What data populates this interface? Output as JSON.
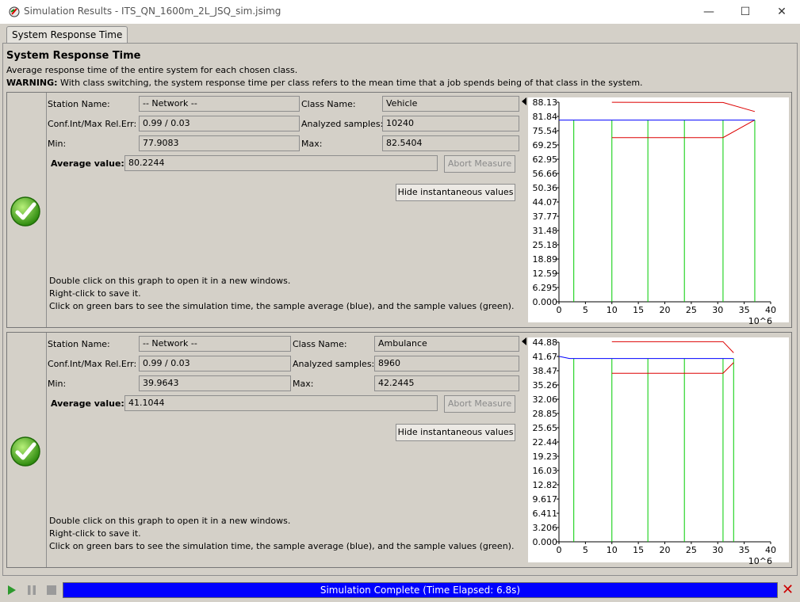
{
  "window": {
    "title": "Simulation Results - ITS_QN_1600m_2L_JSQ_sim.jsimg",
    "minimize": "—",
    "maximize": "☐",
    "close": "✕"
  },
  "tab": {
    "label": "System Response Time"
  },
  "page": {
    "heading": "System Response Time",
    "description": "Average response time of the entire system for each chosen class.",
    "warning_label": "WARNING:",
    "warning_text": " With class switching, the system response time per class refers to the mean time that a job spends being of that class in the system."
  },
  "labels": {
    "station_name": "Station Name:",
    "class_name": "Class Name:",
    "conf_int": "Conf.Int/Max Rel.Err:",
    "analyzed_samples": "Analyzed samples:",
    "min": "Min:",
    "max": "Max:",
    "average_value": "Average value:",
    "abort_measure": "Abort Measure",
    "hide_instantaneous": "Hide instantaneous values",
    "hint_line1": "Double click on this graph to open it in a new windows.",
    "hint_line2": "Right-click to save it.",
    "hint_line3": "Click on green bars to see the simulation time, the sample average (blue), and the sample values (green)."
  },
  "measures": [
    {
      "station_name": "-- Network --",
      "class_name": "Vehicle",
      "conf_int": "0.99 / 0.03",
      "analyzed_samples": "10240",
      "min": "77.9083",
      "max": "82.5404",
      "average_value": "80.2244",
      "status_icon": "check-icon"
    },
    {
      "station_name": "-- Network --",
      "class_name": "Ambulance",
      "conf_int": "0.99 / 0.03",
      "analyzed_samples": "8960",
      "min": "39.9643",
      "max": "42.2445",
      "average_value": "41.1044",
      "status_icon": "check-icon"
    }
  ],
  "charts": [
    {
      "type": "line",
      "y_ticks": [
        "0.000",
        "6.295",
        "12.59",
        "18.89",
        "25.18",
        "31.48",
        "37.77",
        "44.07",
        "50.36",
        "56.66",
        "62.95",
        "69.25",
        "75.54",
        "81.84",
        "88.13"
      ],
      "ylim": [
        0,
        88.13
      ],
      "x_ticks": [
        "0",
        "5",
        "10",
        "15",
        "20",
        "25",
        "30",
        "35",
        "40"
      ],
      "xlim": [
        0,
        40
      ],
      "x_unit": "10^6",
      "average": [
        [
          0,
          80.2
        ],
        [
          37,
          80.2
        ]
      ],
      "upper": [
        [
          10,
          88.1
        ],
        [
          31,
          88.0
        ],
        [
          37,
          84.0
        ]
      ],
      "lower": [
        [
          10,
          72.5
        ],
        [
          31,
          72.5
        ],
        [
          37,
          80.3
        ]
      ],
      "sample_bars": [
        2.8,
        10,
        16.8,
        23.7,
        31,
        37
      ],
      "colors": {
        "average": "#0000ff",
        "confidence": "#dd0000",
        "samples": "#00cc00"
      }
    },
    {
      "type": "line",
      "y_ticks": [
        "0.000",
        "3.206",
        "6.411",
        "9.617",
        "12.82",
        "16.03",
        "19.23",
        "22.44",
        "25.65",
        "28.85",
        "32.06",
        "35.26",
        "38.47",
        "41.67",
        "44.88"
      ],
      "ylim": [
        0,
        44.88
      ],
      "x_ticks": [
        "0",
        "5",
        "10",
        "15",
        "20",
        "25",
        "30",
        "35",
        "40"
      ],
      "xlim": [
        0,
        40
      ],
      "x_unit": "10^6",
      "average": [
        [
          0,
          41.7
        ],
        [
          2,
          41.2
        ],
        [
          33,
          41.2
        ]
      ],
      "upper": [
        [
          10,
          45.0
        ],
        [
          31,
          45.0
        ],
        [
          33,
          42.5
        ]
      ],
      "lower": [
        [
          10,
          37.9
        ],
        [
          31,
          37.9
        ],
        [
          33,
          40.3
        ]
      ],
      "sample_bars": [
        2.8,
        10,
        16.8,
        23.7,
        31,
        33
      ],
      "colors": {
        "average": "#0000ff",
        "confidence": "#dd0000",
        "samples": "#00cc00"
      }
    }
  ],
  "status": {
    "progress_text": "Simulation Complete (Time Elapsed: 6.8s)",
    "progress_color": "#0000ff"
  }
}
